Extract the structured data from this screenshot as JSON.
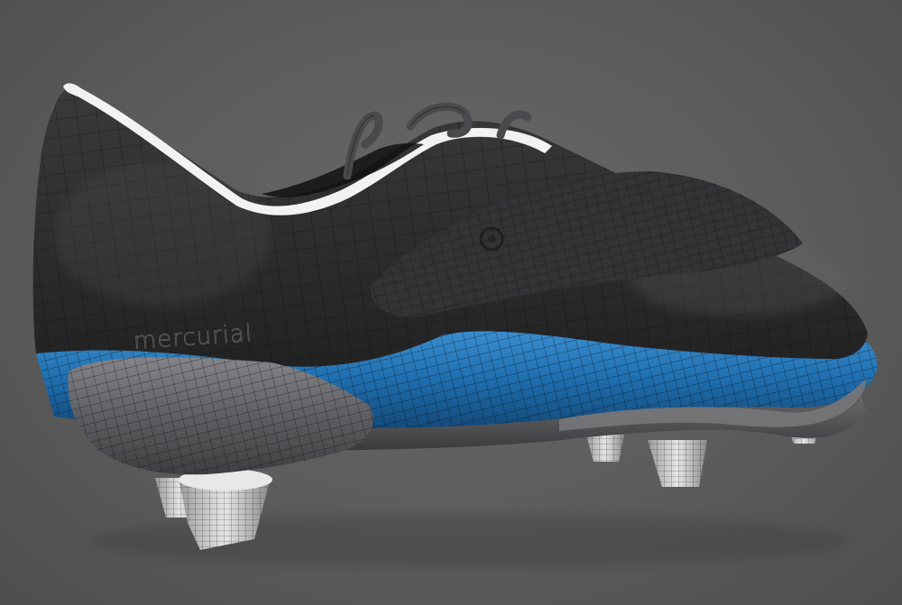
{
  "scene": {
    "subject": "football-boot-3d-model",
    "render_mode": "wireframe-over-shaded",
    "brand_text": "mercurial"
  },
  "colors": {
    "background": "#5c5c5c",
    "upper": "#2e2e2f",
    "upper_highlight": "#4a4a4b",
    "collar_lining": "#f2f2f2",
    "sole_accent": "#1f6fb0",
    "sole_accent_light": "#3a8fd0",
    "heel_counter": "#6b6b6e",
    "studs": "#cfcfcf",
    "wire": "#111111"
  }
}
